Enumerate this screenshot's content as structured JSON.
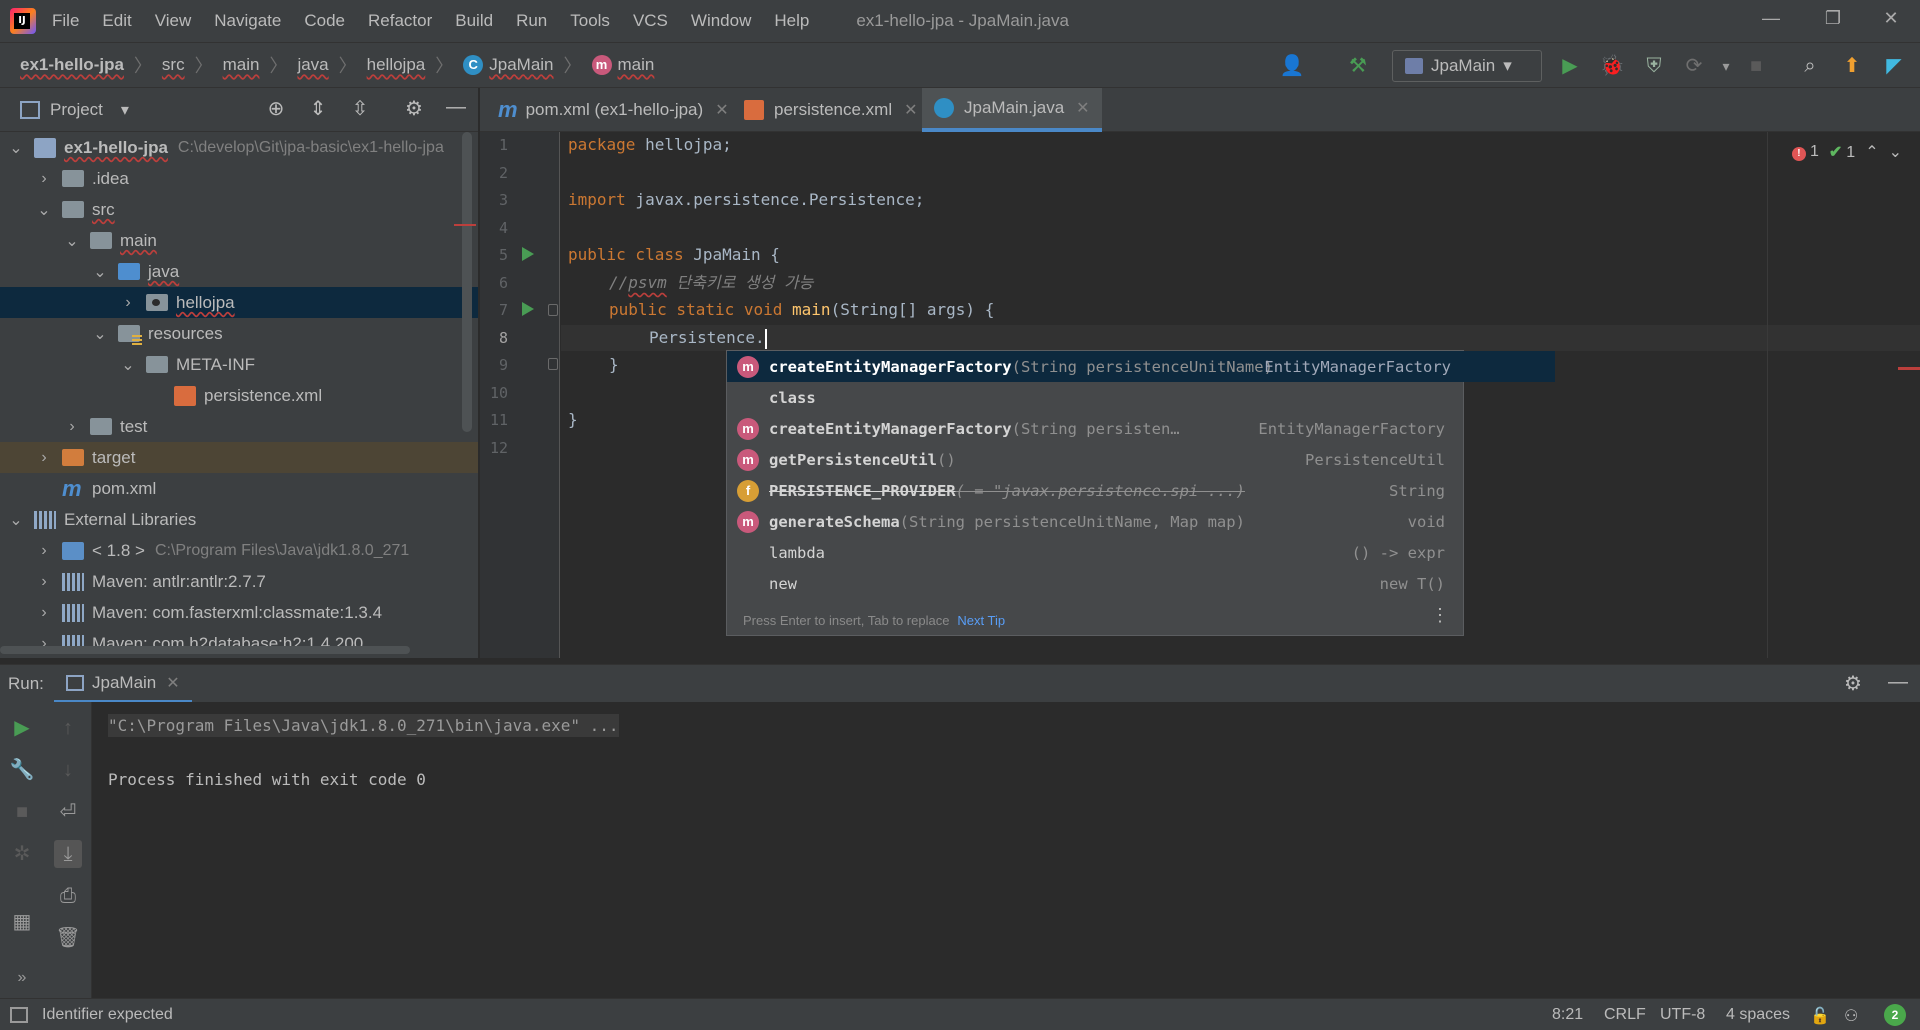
{
  "menu": [
    "File",
    "Edit",
    "View",
    "Navigate",
    "Code",
    "Refactor",
    "Build",
    "Run",
    "Tools",
    "VCS",
    "Window",
    "Help"
  ],
  "window_title": "ex1-hello-jpa - JpaMain.java",
  "window_controls": {
    "minimize": "—",
    "restore": "❐",
    "close": "✕"
  },
  "breadcrumb": [
    "ex1-hello-jpa",
    "src",
    "main",
    "java",
    "hellojpa",
    "JpaMain",
    "main"
  ],
  "toolbar": {
    "run_config": "JpaMain"
  },
  "project": {
    "title": "Project",
    "tree": [
      {
        "label": "ex1-hello-jpa",
        "hint": "C:\\develop\\Git\\jpa-basic\\ex1-hello-jpa"
      },
      {
        "label": ".idea"
      },
      {
        "label": "src"
      },
      {
        "label": "main"
      },
      {
        "label": "java"
      },
      {
        "label": "hellojpa"
      },
      {
        "label": "resources"
      },
      {
        "label": "META-INF"
      },
      {
        "label": "persistence.xml"
      },
      {
        "label": "test"
      },
      {
        "label": "target"
      },
      {
        "label": "pom.xml"
      },
      {
        "label": "External Libraries"
      },
      {
        "label": "< 1.8 >",
        "hint": "C:\\Program Files\\Java\\jdk1.8.0_271"
      },
      {
        "label": "Maven: antlr:antlr:2.7.7"
      },
      {
        "label": "Maven: com.fasterxml:classmate:1.3.4"
      },
      {
        "label": "Maven: com.h2database:h2:1.4.200"
      }
    ]
  },
  "tabs": [
    {
      "label": "pom.xml (ex1-hello-jpa)"
    },
    {
      "label": "persistence.xml"
    },
    {
      "label": "JpaMain.java"
    }
  ],
  "editor": {
    "line_numbers": [
      "1",
      "2",
      "3",
      "4",
      "5",
      "6",
      "7",
      "8",
      "9",
      "10",
      "11",
      "12"
    ],
    "lines": {
      "l1_kw": "package",
      "l1_rest": " hellojpa;",
      "l3_kw": "import",
      "l3_rest": " javax.persistence.Persistence;",
      "l5_kw": "public class",
      "l5_rest": " JpaMain {",
      "l6_cm_a": "//",
      "l6_cm_b": "psvm",
      "l6_cm_c": " 단축키로 생성 가능",
      "l7_kw": "public static void",
      "l7_fn": "main",
      "l7_rest": "(String[] args) {",
      "l8_text": "Persistence.",
      "l9_text": "}",
      "l11_text": "}"
    },
    "inspections": {
      "errors": "1",
      "warnings": "1"
    }
  },
  "completion": {
    "items": [
      {
        "icon": "m",
        "name": "createEntityManagerFactory",
        "sig": "(String persistenceUnitName)",
        "type": "EntityManagerFactory"
      },
      {
        "icon": "",
        "name": "class",
        "sig": "",
        "type": ""
      },
      {
        "icon": "m",
        "name": "createEntityManagerFactory",
        "sig": "(String persisten…",
        "type": "EntityManagerFactory"
      },
      {
        "icon": "m",
        "name": "getPersistenceUtil",
        "sig": "()",
        "type": "PersistenceUtil"
      },
      {
        "icon": "f",
        "name": "PERSISTENCE_PROVIDER",
        "sig": " ( = \"javax.persistence.spi ...)",
        "type": "String"
      },
      {
        "icon": "m",
        "name": "generateSchema",
        "sig": "(String persistenceUnitName, Map map)",
        "type": "void"
      },
      {
        "icon": "",
        "name": "lambda",
        "sig": "",
        "type": "() -> expr"
      },
      {
        "icon": "",
        "name": "new",
        "sig": "",
        "type": "new T()"
      }
    ],
    "footer": "Press Enter to insert, Tab to replace",
    "next_tip": "Next Tip"
  },
  "run": {
    "label": "Run:",
    "tab": "JpaMain",
    "console": [
      "\"C:\\Program Files\\Java\\jdk1.8.0_271\\bin\\java.exe\" ...",
      "Process finished with exit code 0"
    ]
  },
  "status": {
    "message": "Identifier expected",
    "position": "8:21",
    "line_sep": "CRLF",
    "encoding": "UTF-8",
    "indent": "4 spaces",
    "notifications": "2"
  },
  "colors": {
    "accent": "#4a88c7",
    "selection": "#0d293e",
    "run_green": "#499c54",
    "error": "#bc3f3c"
  }
}
